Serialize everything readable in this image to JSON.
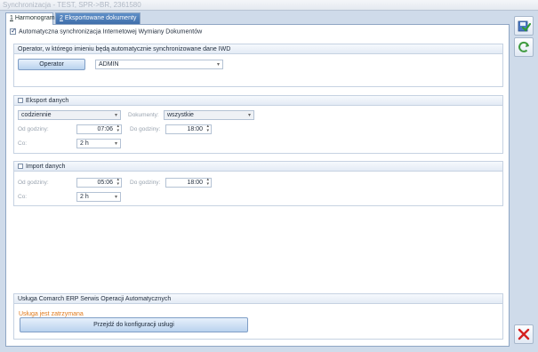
{
  "window": {
    "title": "Synchronizacja - TEST, SPR->BR, 2361580"
  },
  "tabs": [
    {
      "label_prefix": "1",
      "label": "Harmonogram"
    },
    {
      "label_prefix": "2",
      "label": "Eksportowane dokumenty"
    }
  ],
  "auto_sync": {
    "label": "Automatyczna synchronizacja Internetowej Wymiany Dokumentów",
    "checked": true
  },
  "operator_group": {
    "title": "Operator, w którego imieniu będą automatycznie synchronizowane dane IWD",
    "button": "Operator",
    "value": "ADMIN"
  },
  "export_group": {
    "title": "Eksport danych",
    "checked": false,
    "frequency": "codziennie",
    "documents_label": "Dokumenty:",
    "documents_value": "wszystkie",
    "from_label": "Od godziny:",
    "from_value": "07:06",
    "to_label": "Do godziny:",
    "to_value": "18:00",
    "every_label": "Co:",
    "every_value": "2 h"
  },
  "import_group": {
    "title": "Import danych",
    "checked": false,
    "from_label": "Od godziny:",
    "from_value": "05:06",
    "to_label": "Do godziny:",
    "to_value": "18:00",
    "every_label": "Co:",
    "every_value": "2 h"
  },
  "service_group": {
    "title": "Usługa Comarch ERP Serwis Operacji Automatycznych",
    "status": "Usługa jest zatrzymana",
    "button": "Przejdź do konfiguracji usługi"
  },
  "side_buttons": {
    "save_icon": "save-check-icon",
    "refresh_icon": "refresh-icon",
    "close_icon": "close-icon",
    "close_color": "#d42020"
  }
}
